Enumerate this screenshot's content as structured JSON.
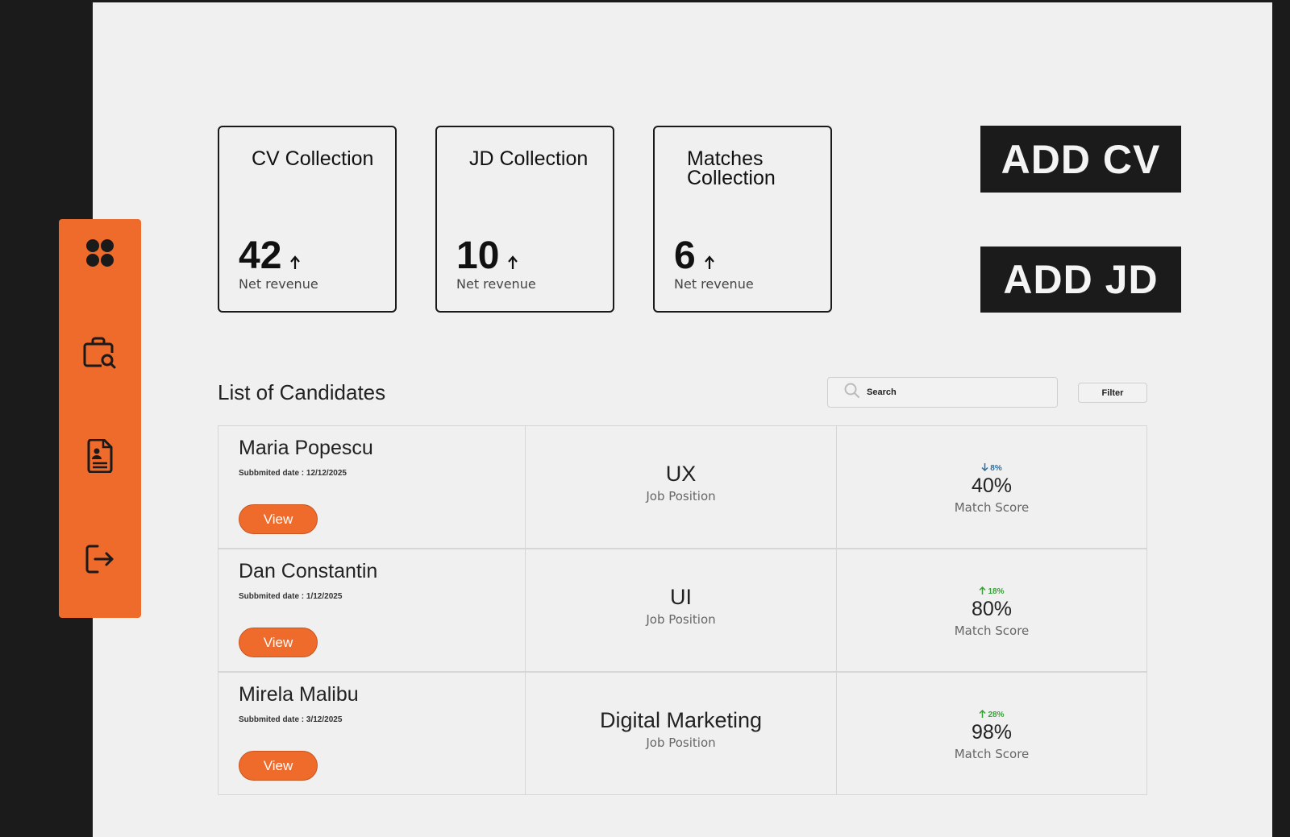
{
  "sidebar": {
    "items": [
      {
        "icon": "dashboard-icon"
      },
      {
        "icon": "job-search-icon"
      },
      {
        "icon": "cv-document-icon"
      },
      {
        "icon": "logout-icon"
      }
    ]
  },
  "stats": [
    {
      "title": "CV Collection",
      "value": "42",
      "sub": "Net revenue"
    },
    {
      "title": "JD Collection",
      "value": "10",
      "sub": "Net revenue"
    },
    {
      "title": "Matches Collection",
      "value": "6",
      "sub": "Net revenue"
    }
  ],
  "actions": {
    "add_cv": "ADD CV",
    "add_jd": "ADD JD"
  },
  "list": {
    "title": "List of Candidates",
    "search_placeholder": "Search",
    "filter_label": "Filter",
    "view_label": "View",
    "position_label": "Job Position",
    "score_label": "Match Score",
    "rows": [
      {
        "name": "Maria Popescu",
        "date": "Subbmited date : 12/12/2025",
        "position": "UX",
        "score": "40%",
        "delta": "8%",
        "delta_dir": "down"
      },
      {
        "name": "Dan Constantin",
        "date": "Subbmited date : 1/12/2025",
        "position": "UI",
        "score": "80%",
        "delta": "18%",
        "delta_dir": "up"
      },
      {
        "name": "Mirela Malibu",
        "date": "Subbmited date : 3/12/2025",
        "position": "Digital Marketing",
        "score": "98%",
        "delta": "28%",
        "delta_dir": "up"
      }
    ]
  },
  "colors": {
    "accent": "#ee6b2c",
    "dark": "#1b1b1b",
    "delta_up": "#3aa13a",
    "delta_down": "#2e6f9e"
  }
}
